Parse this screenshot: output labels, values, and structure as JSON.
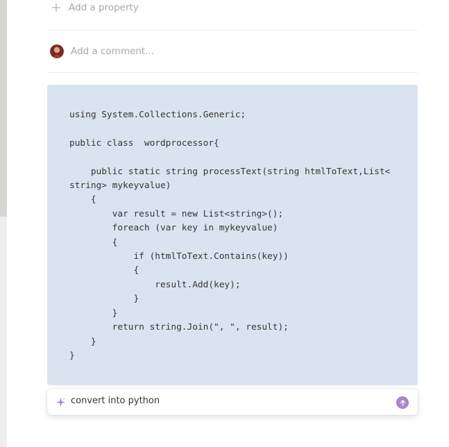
{
  "properties": {
    "add_label": "Add a property"
  },
  "comments": {
    "placeholder": "Add a comment..."
  },
  "code_block": {
    "lines": [
      "using System.Collections.Generic;",
      "",
      "public class  wordprocessor{",
      "",
      "    public static string processText(string htmlToText,List<",
      "string> mykeyvalue)",
      "    {",
      "        var result = new List<string>();",
      "        foreach (var key in mykeyvalue)",
      "        {",
      "            if (htmlToText.Contains(key))",
      "            {",
      "                result.Add(key);",
      "            }",
      "        }",
      "        return string.Join(\", \", result);",
      "    }",
      "}"
    ]
  },
  "ai_prompt": {
    "value": "convert into python"
  },
  "icons": {
    "add_property": "plus-icon",
    "comment_avatar": "avatar",
    "ai": "sparkle-icon",
    "send": "arrow-up-icon"
  },
  "colors": {
    "code_background": "#d9e4f0",
    "send_button": "#a886d0",
    "sparkle": "#a886d0"
  }
}
